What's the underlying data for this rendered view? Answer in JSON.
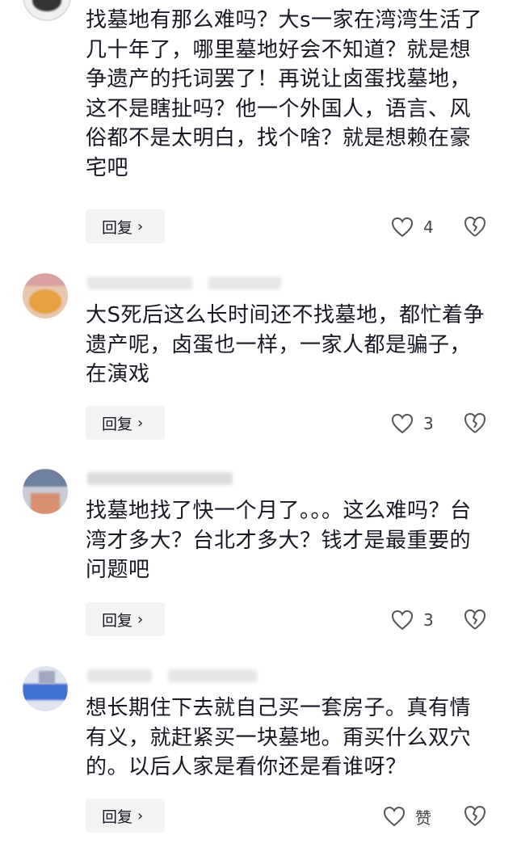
{
  "comments": [
    {
      "text": "找墓地有那么难吗？大s一家在湾湾生活了几十年了，哪里墓地好会不知道？就是想争遗产的托词罢了！再说让卤蛋找墓地，这不是瞎扯吗？他一个外国人，语言、风俗都不是太明白，找个啥？就是想赖在豪宅吧",
      "reply_label": "回复",
      "like_count": "4"
    },
    {
      "text": "大S死后这么长时间还不找墓地，都忙着争遗产呢，卤蛋也一样，一家人都是骗子，在演戏",
      "reply_label": "回复",
      "like_count": "3"
    },
    {
      "text": "找墓地找了快一个月了。。。这么难吗？台湾才多大？台北才多大？钱才是最重要的问题吧",
      "reply_label": "回复",
      "like_count": "3"
    },
    {
      "text": "想长期住下去就自己买一套房子。真有情有义，就赶紧买一块墓地。甭买什么双穴的。以后人家是看你还是看谁呀？",
      "reply_label": "回复",
      "like_count": "赞"
    }
  ],
  "icons": {
    "like": "heart-outline-icon",
    "dislike": "broken-heart-icon",
    "reply_chevron": "chevron-right-icon"
  },
  "colors": {
    "text": "#161823",
    "reply_bg": "#f3f3f4",
    "icon": "#555555"
  }
}
